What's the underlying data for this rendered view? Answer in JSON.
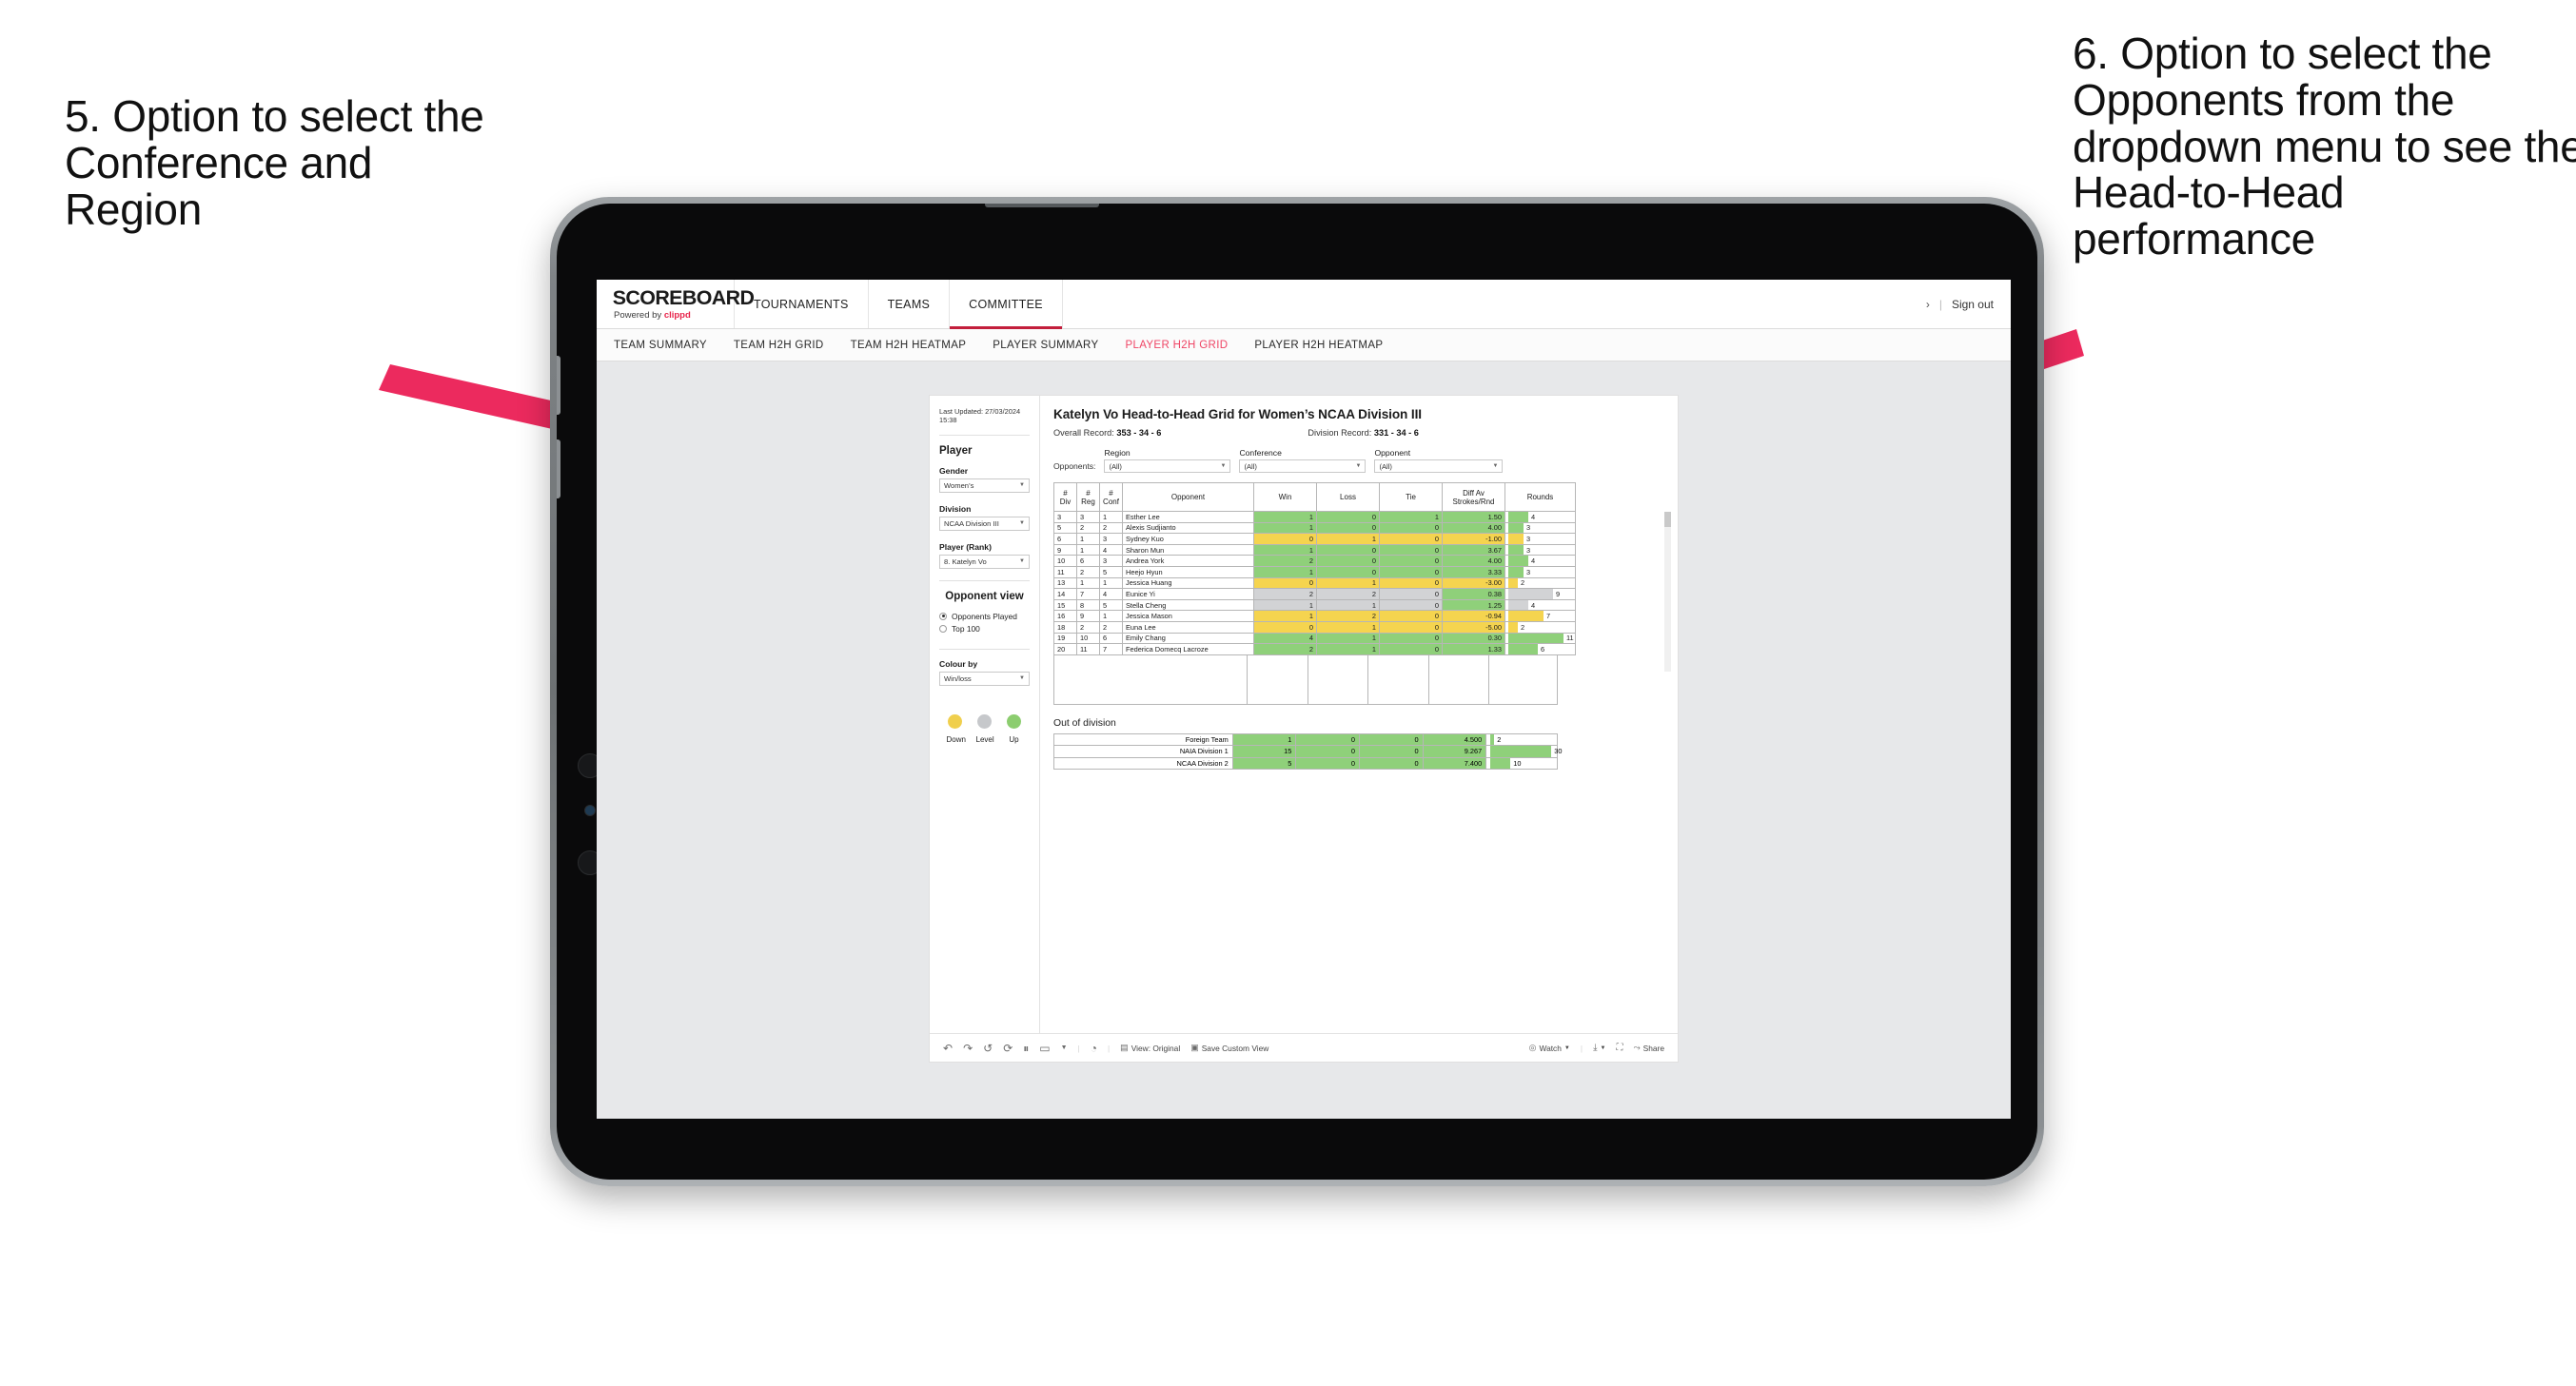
{
  "annotations": {
    "left": "5. Option to select the Conference and Region",
    "right": "6. Option to select the Opponents from the dropdown menu to see the Head-to-Head performance",
    "arrow_color": "#ec2a5e"
  },
  "app": {
    "brand": {
      "title": "SCOREBOARD",
      "powered_prefix": "Powered by ",
      "powered_name": "clippd"
    },
    "top_nav": [
      {
        "label": "TOURNAMENTS",
        "active": false
      },
      {
        "label": "TEAMS",
        "active": false
      },
      {
        "label": "COMMITTEE",
        "active": true
      }
    ],
    "header_right": {
      "chevron": "›",
      "separator": "|",
      "sign_out": "Sign out"
    },
    "sub_nav": [
      {
        "label": "TEAM SUMMARY",
        "active": false
      },
      {
        "label": "TEAM H2H GRID",
        "active": false
      },
      {
        "label": "TEAM H2H HEATMAP",
        "active": false
      },
      {
        "label": "PLAYER SUMMARY",
        "active": false
      },
      {
        "label": "PLAYER H2H GRID",
        "active": true
      },
      {
        "label": "PLAYER H2H HEATMAP",
        "active": false
      }
    ]
  },
  "sidebar": {
    "last_updated": "Last Updated: 27/03/2024 15:38",
    "player_heading": "Player",
    "fields": [
      {
        "label": "Gender",
        "value": "Women’s"
      },
      {
        "label": "Division",
        "value": "NCAA Division III"
      },
      {
        "label": "Player (Rank)",
        "value": "8. Katelyn Vo"
      }
    ],
    "opponent_view": {
      "heading": "Opponent view",
      "options": [
        {
          "label": "Opponents Played",
          "selected": true
        },
        {
          "label": "Top 100",
          "selected": false
        }
      ]
    },
    "colour_by": {
      "label": "Colour by",
      "value": "Win/loss"
    },
    "legend": [
      {
        "label": "Down",
        "color": "#f0cf4d"
      },
      {
        "label": "Level",
        "color": "#c6c8cb"
      },
      {
        "label": "Up",
        "color": "#8ccd6f"
      }
    ]
  },
  "viz": {
    "title": "Katelyn Vo Head-to-Head Grid for Women’s NCAA Division III",
    "overall_record_label": "Overall Record:",
    "overall_record_value": "353 - 34 - 6",
    "division_record_label": "Division Record:",
    "division_record_value": "331 - 34 - 6",
    "opponents_label": "Opponents:",
    "filters": [
      {
        "name": "Region",
        "value": "(All)"
      },
      {
        "name": "Conference",
        "value": "(All)"
      },
      {
        "name": "Opponent",
        "value": "(All)"
      }
    ],
    "out_of_division_title": "Out of division"
  },
  "chart_data": {
    "type": "table",
    "title": "Katelyn Vo Head-to-Head Grid for Women’s NCAA Division III",
    "columns": [
      "# Div",
      "# Reg",
      "# Conf",
      "Opponent",
      "Win",
      "Loss",
      "Tie",
      "Diff Av Strokes/Rnd",
      "Rounds"
    ],
    "column_headers_multiline": [
      {
        "line1": "#",
        "line2": "Div"
      },
      {
        "line1": "#",
        "line2": "Reg"
      },
      {
        "line1": "#",
        "line2": "Conf"
      },
      {
        "line1": "Opponent",
        "line2": ""
      },
      {
        "line1": "Win",
        "line2": ""
      },
      {
        "line1": "Loss",
        "line2": ""
      },
      {
        "line1": "Tie",
        "line2": ""
      },
      {
        "line1": "Diff Av",
        "line2": "Strokes/Rnd"
      },
      {
        "line1": "Rounds",
        "line2": ""
      }
    ],
    "rounds_axis_max": 13,
    "colors": {
      "up": "#8fd07a",
      "down": "#f5d44f",
      "level": "#d2d3d5"
    },
    "rows": [
      {
        "div": "3",
        "reg": "3",
        "conf": "1",
        "opponent": "Esther Lee",
        "win": "1",
        "loss": "0",
        "tie": "1",
        "diff": "1.50",
        "rounds": 4,
        "color": "up"
      },
      {
        "div": "5",
        "reg": "2",
        "conf": "2",
        "opponent": "Alexis Sudjianto",
        "win": "1",
        "loss": "0",
        "tie": "0",
        "diff": "4.00",
        "rounds": 3,
        "color": "up"
      },
      {
        "div": "6",
        "reg": "1",
        "conf": "3",
        "opponent": "Sydney Kuo",
        "win": "0",
        "loss": "1",
        "tie": "0",
        "diff": "-1.00",
        "rounds": 3,
        "color": "down"
      },
      {
        "div": "9",
        "reg": "1",
        "conf": "4",
        "opponent": "Sharon Mun",
        "win": "1",
        "loss": "0",
        "tie": "0",
        "diff": "3.67",
        "rounds": 3,
        "color": "up"
      },
      {
        "div": "10",
        "reg": "6",
        "conf": "3",
        "opponent": "Andrea York",
        "win": "2",
        "loss": "0",
        "tie": "0",
        "diff": "4.00",
        "rounds": 4,
        "color": "up"
      },
      {
        "div": "11",
        "reg": "2",
        "conf": "5",
        "opponent": "Heejo Hyun",
        "win": "1",
        "loss": "0",
        "tie": "0",
        "diff": "3.33",
        "rounds": 3,
        "color": "up"
      },
      {
        "div": "13",
        "reg": "1",
        "conf": "1",
        "opponent": "Jessica Huang",
        "win": "0",
        "loss": "1",
        "tie": "0",
        "diff": "-3.00",
        "rounds": 2,
        "color": "down"
      },
      {
        "div": "14",
        "reg": "7",
        "conf": "4",
        "opponent": "Eunice Yi",
        "win": "2",
        "loss": "2",
        "tie": "0",
        "diff": "0.38",
        "rounds": 9,
        "color": "level",
        "diff_color": "up"
      },
      {
        "div": "15",
        "reg": "8",
        "conf": "5",
        "opponent": "Stella Cheng",
        "win": "1",
        "loss": "1",
        "tie": "0",
        "diff": "1.25",
        "rounds": 4,
        "color": "level",
        "diff_color": "up"
      },
      {
        "div": "16",
        "reg": "9",
        "conf": "1",
        "opponent": "Jessica Mason",
        "win": "1",
        "loss": "2",
        "tie": "0",
        "diff": "-0.94",
        "rounds": 7,
        "color": "down"
      },
      {
        "div": "18",
        "reg": "2",
        "conf": "2",
        "opponent": "Euna Lee",
        "win": "0",
        "loss": "1",
        "tie": "0",
        "diff": "-5.00",
        "rounds": 2,
        "color": "down"
      },
      {
        "div": "19",
        "reg": "10",
        "conf": "6",
        "opponent": "Emily Chang",
        "win": "4",
        "loss": "1",
        "tie": "0",
        "diff": "0.30",
        "rounds": 11,
        "color": "up"
      },
      {
        "div": "20",
        "reg": "11",
        "conf": "7",
        "opponent": "Federica Domecq Lacroze",
        "win": "2",
        "loss": "1",
        "tie": "0",
        "diff": "1.33",
        "rounds": 6,
        "color": "up"
      }
    ],
    "out_of_division": {
      "title": "Out of division",
      "rounds_axis_max": 32,
      "rows": [
        {
          "name": "Foreign Team",
          "win": "1",
          "loss": "0",
          "tie": "0",
          "diff": "4.500",
          "rounds": 2,
          "color": "up"
        },
        {
          "name": "NAIA Division 1",
          "win": "15",
          "loss": "0",
          "tie": "0",
          "diff": "9.267",
          "rounds": 30,
          "color": "up"
        },
        {
          "name": "NCAA Division 2",
          "win": "5",
          "loss": "0",
          "tie": "0",
          "diff": "7.400",
          "rounds": 10,
          "color": "up"
        }
      ]
    }
  },
  "toolbar": {
    "icons": [
      "undo-icon",
      "redo-icon",
      "revert-icon",
      "refresh-icon",
      "pause-icon",
      "collapse-icon"
    ],
    "alerts_icon": "alerts-icon",
    "view_label": "View: Original",
    "save_custom_view_label": "Save Custom View",
    "watch_label": "Watch",
    "download_icon": "download-icon",
    "fullscreen_icon": "fullscreen-icon",
    "share_label": "Share"
  }
}
